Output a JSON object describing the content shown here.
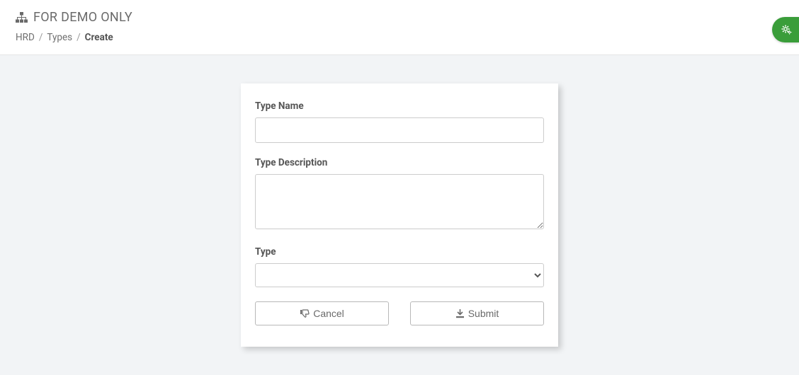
{
  "header": {
    "title": "FOR DEMO ONLY"
  },
  "breadcrumb": {
    "items": [
      "HRD",
      "Types",
      "Create"
    ],
    "separator": "/"
  },
  "form": {
    "fields": {
      "name": {
        "label": "Type Name",
        "value": ""
      },
      "description": {
        "label": "Type Description",
        "value": ""
      },
      "type": {
        "label": "Type",
        "value": ""
      }
    },
    "buttons": {
      "cancel": "Cancel",
      "submit": "Submit"
    }
  }
}
